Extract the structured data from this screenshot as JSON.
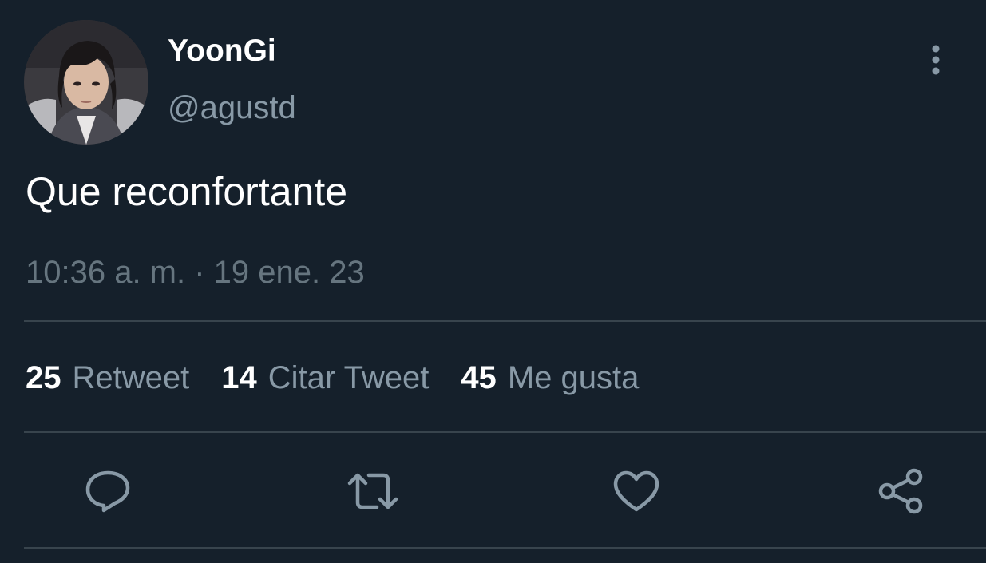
{
  "tweet": {
    "display_name": "YoonGi",
    "handle": "@agustd",
    "text": "Que reconfortante",
    "timestamp": "10:36 a. m. · 19 ene. 23"
  },
  "stats": [
    {
      "count": "25",
      "label": "Retweet"
    },
    {
      "count": "14",
      "label": "Citar Tweet"
    },
    {
      "count": "45",
      "label": "Me gusta"
    }
  ],
  "actions": {
    "reply_icon": "reply-icon",
    "retweet_icon": "retweet-icon",
    "like_icon": "heart-icon",
    "share_icon": "share-icon",
    "more_icon": "more-vertical-icon"
  },
  "colors": {
    "background": "#15202b",
    "primary_text": "#ffffff",
    "secondary_text": "#8899a6",
    "divider": "#38444d"
  }
}
